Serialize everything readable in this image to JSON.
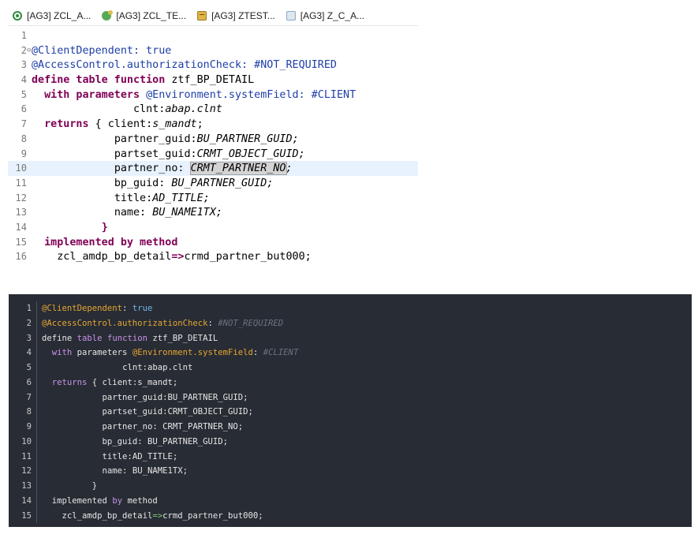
{
  "tabs": [
    {
      "label": "[AG3] ZCL_A...",
      "icon": "class-run-icon"
    },
    {
      "label": "[AG3] ZCL_TE...",
      "icon": "class-icon"
    },
    {
      "label": "[AG3] ZTEST...",
      "icon": "program-icon"
    },
    {
      "label": "[AG3] Z_C_A...",
      "icon": "ddl-icon"
    }
  ],
  "top_editor": {
    "line_numbers": [
      "1",
      "2",
      "3",
      "4",
      "5",
      "6",
      "7",
      "8",
      "9",
      "10",
      "11",
      "12",
      "13",
      "14",
      "15",
      "16"
    ],
    "l2": {
      "ann": "@ClientDependent",
      "rest": ": true"
    },
    "l3": {
      "ann": "@AccessControl.authorizationCheck",
      "rest": ": #NOT_REQUIRED"
    },
    "l4": {
      "kw": "define table function",
      "rest": " ztf_BP_DETAIL"
    },
    "l5": {
      "kw": "with parameters",
      "ann": "@Environment.systemField",
      "rest": ": #CLIENT"
    },
    "l6": {
      "name": "clnt:",
      "type": "abap.clnt"
    },
    "l7": {
      "kw": "returns",
      "open": " { ",
      "name": "client:",
      "type": "s_mandt",
      "end": ";"
    },
    "l8": {
      "name": "partner_guid:",
      "type": "BU_PARTNER_GUID",
      "end": ";"
    },
    "l9": {
      "name": "partset_guid:",
      "type": "CRMT_OBJECT_GUID",
      "end": ";"
    },
    "l10": {
      "name": "partner_no: ",
      "type": "CRMT_PARTNER_NO",
      "end": ";"
    },
    "l11": {
      "name": "bp_guid: ",
      "type": "BU_PARTNER_GUID",
      "end": ";"
    },
    "l12": {
      "name": "title:",
      "type": "AD_TITLE",
      "end": ";"
    },
    "l13": {
      "name": "name: ",
      "type": "BU_NAME1TX",
      "end": ";"
    },
    "l14": {
      "close": "}"
    },
    "l15": {
      "kw": "implemented by method"
    },
    "l16": {
      "cls": "zcl_amdp_bp_detail",
      "arrow": "=>",
      "meth": "crmd_partner_but000;"
    }
  },
  "bottom_editor": {
    "line_numbers": [
      "1",
      "2",
      "3",
      "4",
      "5",
      "6",
      "7",
      "8",
      "9",
      "10",
      "11",
      "12",
      "13",
      "14",
      "15"
    ],
    "l1": {
      "ann": "@ClientDependent",
      "colon": ": ",
      "val": "true"
    },
    "l2": {
      "ann": "@AccessControl.authorizationCheck",
      "colon": ": ",
      "cmt": "#NOT_REQUIRED"
    },
    "l3": {
      "a": "define ",
      "kw1": "table",
      "b": " ",
      "kw2": "function",
      "c": " ztf_BP_DETAIL"
    },
    "l4": {
      "kw": "with",
      "a": " parameters ",
      "ann": "@Environment.systemField",
      "colon": ": ",
      "cmt": "#CLIENT"
    },
    "l5": {
      "text": "clnt:abap.clnt"
    },
    "l6": {
      "kw": "returns",
      "text": " { client:s_mandt;"
    },
    "l7": {
      "text": "partner_guid:BU_PARTNER_GUID;"
    },
    "l8": {
      "text": "partset_guid:CRMT_OBJECT_GUID;"
    },
    "l9": {
      "text": "partner_no: CRMT_PARTNER_NO;"
    },
    "l10": {
      "text": "bp_guid: BU_PARTNER_GUID;"
    },
    "l11": {
      "text": "title:AD_TITLE;"
    },
    "l12": {
      "text": "name: BU_NAME1TX;"
    },
    "l13": {
      "text": "}"
    },
    "l14": {
      "a": "implemented ",
      "kw": "by",
      "b": " method"
    },
    "l15": {
      "cls": "zcl_amdp_bp_detail",
      "arrow": "=>",
      "meth": "crmd_partner_but000;"
    }
  }
}
